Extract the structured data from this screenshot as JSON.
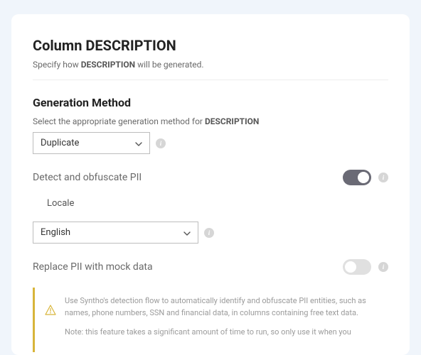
{
  "header": {
    "title": "Column DESCRIPTION",
    "subtitle_pre": "Specify how ",
    "subtitle_bold": "DESCRIPTION",
    "subtitle_post": " will be generated."
  },
  "generation": {
    "heading": "Generation Method",
    "helper_pre": "Select the appropriate generation method for ",
    "helper_bold": "DESCRIPTION",
    "selected": "Duplicate"
  },
  "pii": {
    "detect_label": "Detect and obfuscate PII",
    "locale_label": "Locale",
    "locale_value": "English",
    "replace_label": "Replace PII with mock data"
  },
  "notice": {
    "line1": "Use Syntho's detection flow to automatically identify and obfuscate PII entities, such as names, phone numbers, SSN and financial data, in columns containing free text data.",
    "line2": "Note: this feature takes a significant amount of time to run, so only use it when you"
  }
}
